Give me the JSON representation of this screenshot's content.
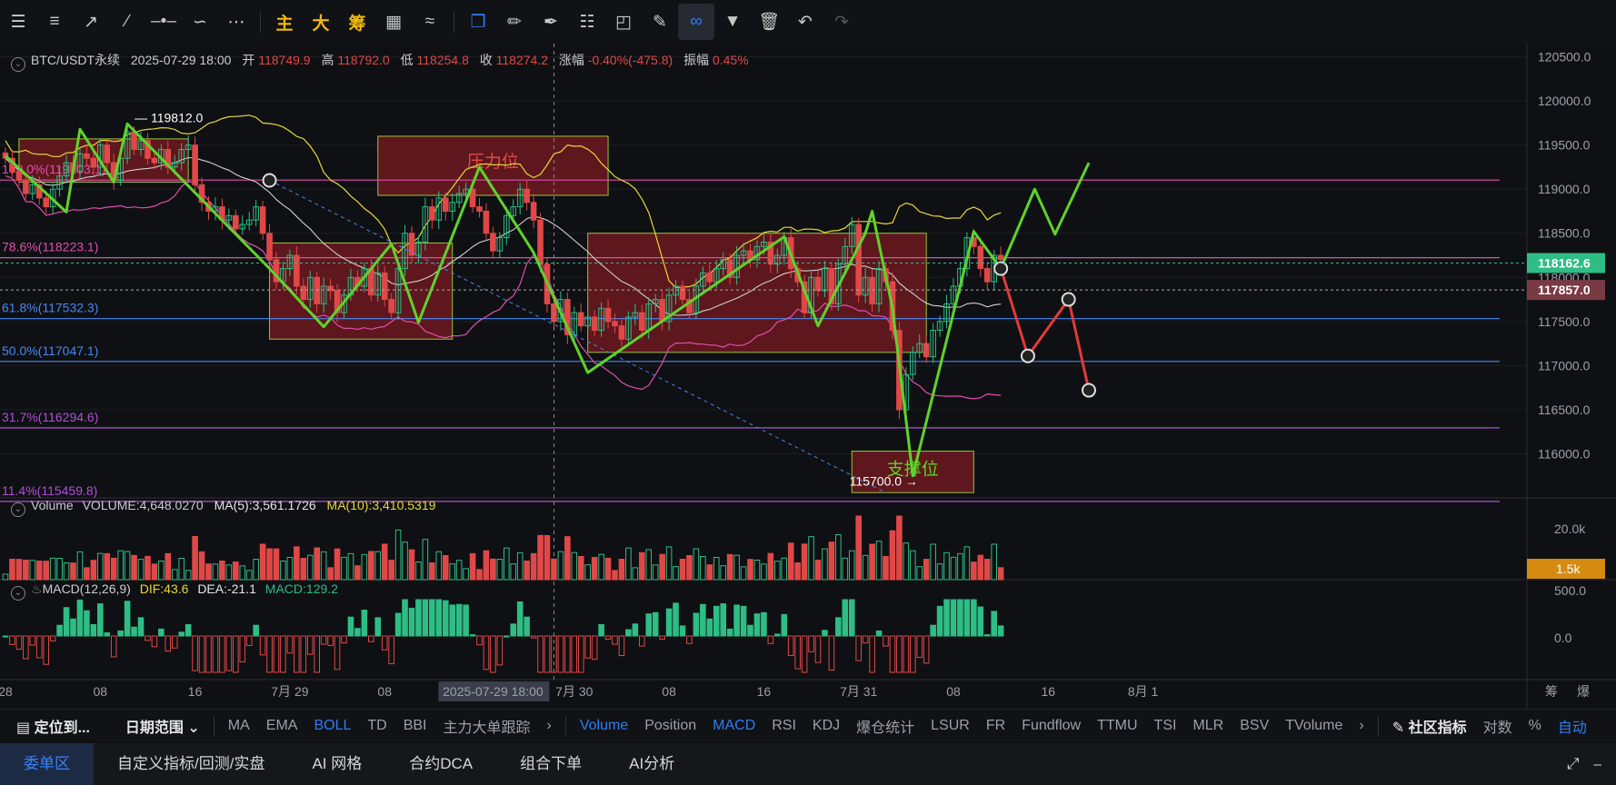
{
  "toolbar": {
    "icons": [
      "menu-icon",
      "settings-lines-icon",
      "ray-icon",
      "line-icon",
      "horizontal-line-icon",
      "wave-icon",
      "more-icon"
    ],
    "main_label": "主",
    "big_label": "大",
    "chip_label": "筹",
    "right_icons": [
      "select-icon",
      "ruler-icon",
      "pen-icon",
      "pattern-icon",
      "delete-tool-icon",
      "note-icon",
      "magnet-icon",
      "filter-icon",
      "trash-icon",
      "undo-icon",
      "redo-icon"
    ]
  },
  "info": {
    "symbol": "BTC/USDT永续",
    "datetime": "2025-07-29 18:00",
    "open_label": "开",
    "open": "118749.9",
    "high_label": "高",
    "high": "118792.0",
    "low_label": "低",
    "low": "118254.8",
    "close_label": "收",
    "close": "118274.2",
    "change_label": "涨幅",
    "change": "-0.40%(-475.8)",
    "amp_label": "振幅",
    "amp": "0.45%"
  },
  "volume_info": {
    "label": "Volume",
    "vol": "VOLUME:4,648.0270",
    "ma5": "MA(5):3,561.1726",
    "ma10": "MA(10):3,410.5319"
  },
  "macd_info": {
    "label": "MACD(12,26,9)",
    "dif": "DIF:43.6",
    "dea": "DEA:-21.1",
    "macd": "MACD:129.2"
  },
  "colors": {
    "up": "#2ebd85",
    "down": "#e04848",
    "boll_up": "#e6d83a",
    "boll_mid": "#cfcfcf",
    "boll_low": "#e04fae",
    "zone": "#7a1a22",
    "zone_border": "#9ac43a",
    "arrow_green": "#5fd32a",
    "arrow_red": "#e23a3a"
  },
  "chart_data": {
    "type": "candlestick",
    "ylim": [
      115500,
      120650
    ],
    "y_ticks": [
      120500,
      120000,
      119500,
      119000,
      118500,
      118000,
      117500,
      117000,
      116500,
      116000
    ],
    "y_tick_labels": [
      "120500.0",
      "120000.0",
      "119500.0",
      "119000.0",
      "118500.0",
      "118000.0",
      "117500.0",
      "117000.0",
      "116500.0",
      "116000.0"
    ],
    "price_tags": [
      {
        "text": "118162.6",
        "value": 118162.6,
        "color": "#2ebd85"
      },
      {
        "text": "117857.0",
        "value": 117857,
        "color": "#7a3a44"
      }
    ],
    "x_labels": [
      "28",
      "08",
      "16",
      "7月 29",
      "08",
      "2025-07-29 18:00",
      "7月 30",
      "08",
      "16",
      "7月 31",
      "08",
      "16",
      "8月 1"
    ],
    "x_label_index": [
      0,
      14,
      28,
      42,
      56,
      72,
      84,
      98,
      112,
      126,
      140,
      154,
      168
    ],
    "fib_levels": [
      {
        "label": "100.0%(119103.1)",
        "value": 119103.1,
        "color": "#e04fae"
      },
      {
        "label": "78.6%(118223.1)",
        "value": 118223.1,
        "color": "#e04fae"
      },
      {
        "label": "61.8%(117532.3)",
        "value": 117532.3,
        "color": "#4a86f0"
      },
      {
        "label": "50.0%(117047.1)",
        "value": 117047.1,
        "color": "#4a86f0"
      },
      {
        "label": "31.7%(116294.6)",
        "value": 116294.6,
        "color": "#b04fd8"
      },
      {
        "label": "11.4%(115459.8)",
        "value": 115459.8,
        "color": "#b04fd8"
      }
    ],
    "zones": [
      {
        "i0": 2,
        "i1": 27,
        "top": 119570,
        "bottom": 119080,
        "label": ""
      },
      {
        "i0": 39,
        "i1": 66,
        "top": 118390,
        "bottom": 117300,
        "label": ""
      },
      {
        "i0": 55,
        "i1": 89,
        "top": 119600,
        "bottom": 118930,
        "label": "压力位"
      },
      {
        "i0": 86,
        "i1": 136,
        "top": 118500,
        "bottom": 117150,
        "label": ""
      },
      {
        "i0": 125,
        "i1": 143,
        "top": 116030,
        "bottom": 115560,
        "label": "支撑位"
      }
    ],
    "annotations": [
      {
        "text": "119812.0",
        "index": 18,
        "value": 119812
      },
      {
        "text": "115700.0",
        "index": 126,
        "value": 115700
      }
    ],
    "green_path": [
      [
        0,
        119380
      ],
      [
        9,
        118740
      ],
      [
        11,
        119680
      ],
      [
        16,
        119080
      ],
      [
        18,
        119740
      ],
      [
        39,
        118100
      ],
      [
        47,
        117440
      ],
      [
        57,
        118380
      ],
      [
        61,
        117490
      ],
      [
        70,
        119250
      ],
      [
        78,
        118280
      ],
      [
        86,
        116920
      ],
      [
        115,
        118460
      ],
      [
        120,
        117450
      ],
      [
        127,
        118500
      ],
      [
        128,
        118750
      ],
      [
        131,
        117650
      ],
      [
        134,
        115750
      ],
      [
        143,
        118520
      ],
      [
        147,
        118100
      ],
      [
        152,
        119000
      ],
      [
        155,
        118490
      ],
      [
        160,
        119300
      ]
    ],
    "red_path": [
      [
        147,
        118100
      ],
      [
        151,
        117110
      ],
      [
        157,
        117750
      ],
      [
        160,
        116720
      ]
    ],
    "circles": [
      [
        39,
        119100
      ],
      [
        147,
        118100
      ],
      [
        151,
        117110
      ],
      [
        157,
        117750
      ],
      [
        160,
        116720
      ]
    ],
    "candles_close": [
      119350,
      119200,
      119100,
      118950,
      119050,
      118900,
      118800,
      119000,
      119150,
      119300,
      119200,
      119400,
      119350,
      119250,
      119500,
      119300,
      119100,
      119350,
      119650,
      119450,
      119550,
      119350,
      119300,
      119450,
      119250,
      119300,
      119450,
      119500,
      119050,
      118850,
      118750,
      118800,
      118650,
      118700,
      118550,
      118600,
      118650,
      118800,
      118500,
      118200,
      117950,
      118100,
      118250,
      117900,
      117750,
      118000,
      117700,
      117900,
      117850,
      117600,
      117800,
      118000,
      117900,
      118100,
      117800,
      118050,
      117750,
      117600,
      118100,
      118500,
      118250,
      118400,
      118800,
      118650,
      118900,
      118750,
      118850,
      118950,
      119000,
      118800,
      118750,
      118500,
      118300,
      118450,
      118700,
      118800,
      119000,
      118850,
      118650,
      118150,
      117700,
      117500,
      117750,
      117350,
      117600,
      117450,
      117550,
      117400,
      117650,
      117500,
      117450,
      117300,
      117550,
      117600,
      117400,
      117700,
      117750,
      117500,
      117800,
      117900,
      117750,
      117600,
      117900,
      118050,
      117950,
      118100,
      118200,
      118000,
      118250,
      118300,
      118200,
      118350,
      118400,
      118150,
      118250,
      118450,
      118100,
      117950,
      117600,
      118000,
      117850,
      118100,
      117700,
      118150,
      118350,
      118600,
      117800,
      118000,
      117700,
      118100,
      117950,
      117400,
      116500,
      116900,
      117150,
      117250,
      117100,
      117400,
      117500,
      117700,
      117900,
      118100,
      118450,
      118350,
      118100,
      117950,
      118250,
      118200
    ]
  },
  "volume_axis": {
    "tick": "20.0k",
    "tag": "1.5k"
  },
  "macd_axis": {
    "ticks": [
      "500.0",
      "0.0"
    ]
  },
  "indicator_bar": {
    "locate": "定位到...",
    "range": "日期范围",
    "main_items": [
      "MA",
      "EMA",
      "BOLL",
      "TD",
      "BBI",
      "主力大单跟踪"
    ],
    "sub_items": [
      "Volume",
      "Position",
      "MACD",
      "RSI",
      "KDJ",
      "爆仓统计",
      "LSUR",
      "FR",
      "Fundflow",
      "TTMU",
      "TSI",
      "MLR",
      "BSV",
      "TVolume"
    ],
    "community": "社区指标",
    "log": "对数",
    "pct": "%",
    "auto": "自动"
  },
  "right_labels": {
    "chips": "筹",
    "boom": "爆"
  },
  "bottom_tabs": [
    "委单区",
    "自定义指标/回测/实盘",
    "AI 网格",
    "合约DCA",
    "组合下单",
    "AI分析"
  ]
}
